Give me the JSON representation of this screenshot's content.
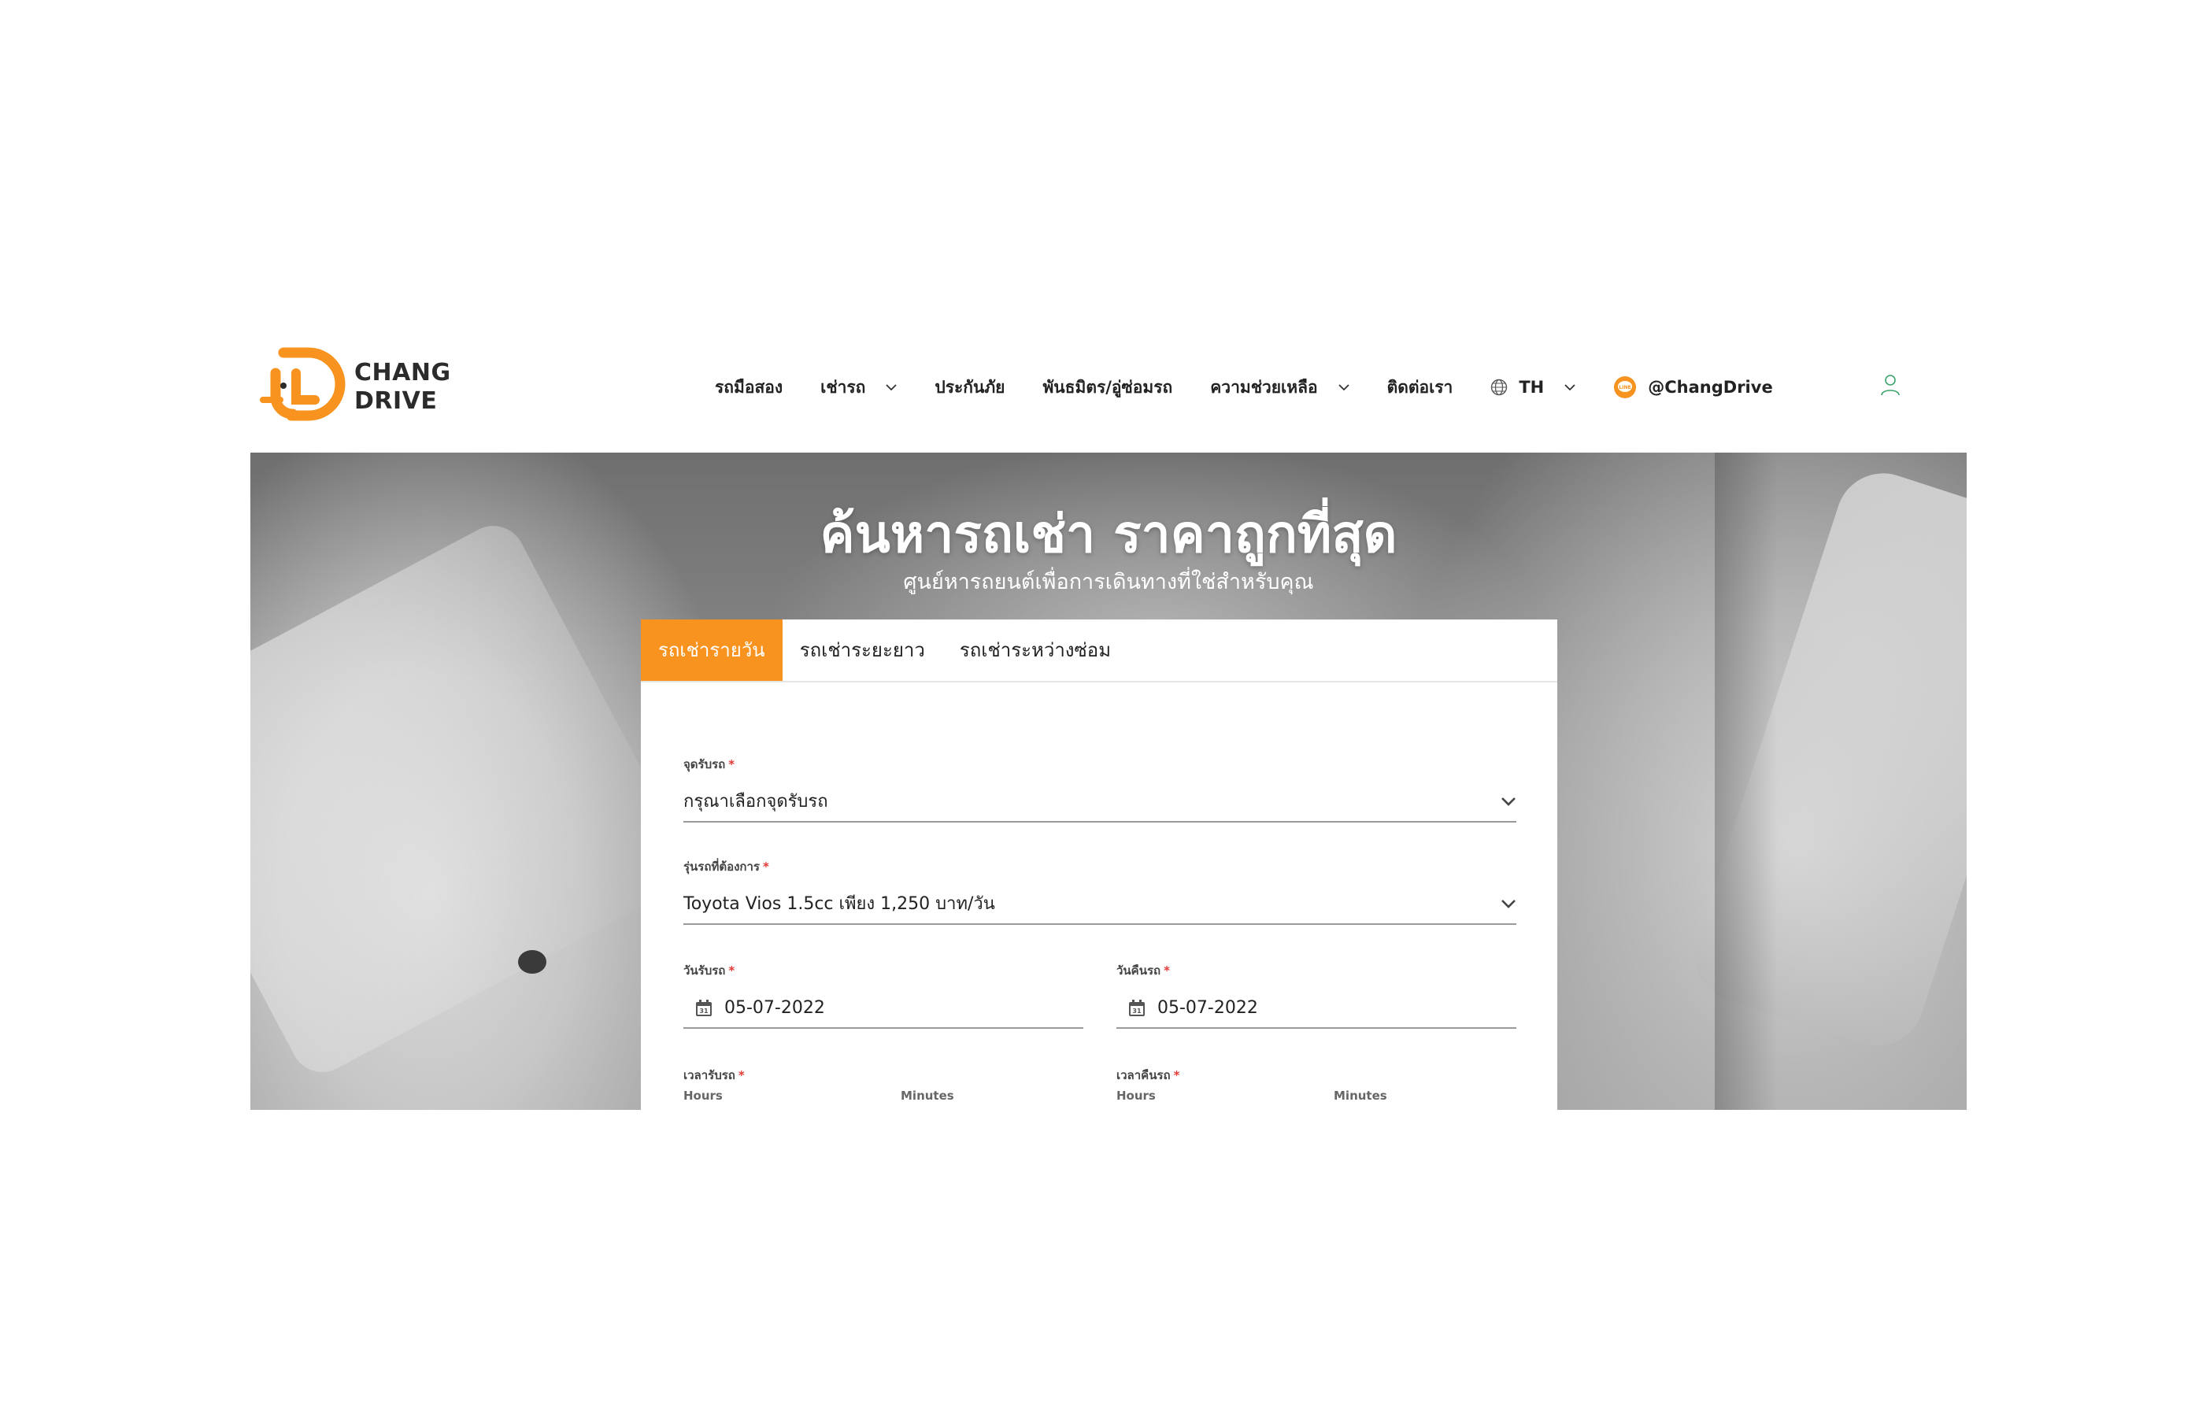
{
  "brand": {
    "line1": "CHANG",
    "line2": "DRIVE",
    "accent": "#f7931e"
  },
  "nav": {
    "items": [
      {
        "label": "รถมือสอง",
        "has_dropdown": false
      },
      {
        "label": "เช่ารถ",
        "has_dropdown": true
      },
      {
        "label": "ประกันภัย",
        "has_dropdown": false
      },
      {
        "label": "พันธมิตร/อู่ซ่อมรถ",
        "has_dropdown": false
      },
      {
        "label": "ความช่วยเหลือ",
        "has_dropdown": true
      },
      {
        "label": "ติดต่อเรา",
        "has_dropdown": false
      }
    ],
    "language": "TH",
    "line_account": "@ChangDrive",
    "icons": {
      "language": "globe-icon",
      "line": "line-icon",
      "account": "user-icon"
    }
  },
  "hero": {
    "title": "ค้นหารถเช่า ราคาถูกที่สุด",
    "subtitle": "ศูนย์หารถยนต์เพื่อการเดินทางที่ใช่สำหรับคุณ"
  },
  "search": {
    "tabs": [
      {
        "label": "รถเช่ารายวัน",
        "active": true
      },
      {
        "label": "รถเช่าระยะยาว",
        "active": false
      },
      {
        "label": "รถเช่าระหว่างซ่อม",
        "active": false
      }
    ],
    "pickup_location": {
      "label": "จุดรับรถ",
      "required_mark": "*",
      "value": "กรุณาเลือกจุดรับรถ"
    },
    "car_model": {
      "label": "รุ่นรถที่ต้องการ",
      "required_mark": "*",
      "value": "Toyota Vios 1.5cc เพียง 1,250 บาท/วัน"
    },
    "pickup_date": {
      "label": "วันรับรถ",
      "required_mark": "*",
      "value": "05-07-2022"
    },
    "return_date": {
      "label": "วันคืนรถ",
      "required_mark": "*",
      "value": "05-07-2022"
    },
    "pickup_time": {
      "label": "เวลารับรถ",
      "required_mark": "*",
      "hours_label": "Hours",
      "minutes_label": "Minutes"
    },
    "return_time": {
      "label": "เวลาคืนรถ",
      "required_mark": "*",
      "hours_label": "Hours",
      "minutes_label": "Minutes"
    }
  }
}
